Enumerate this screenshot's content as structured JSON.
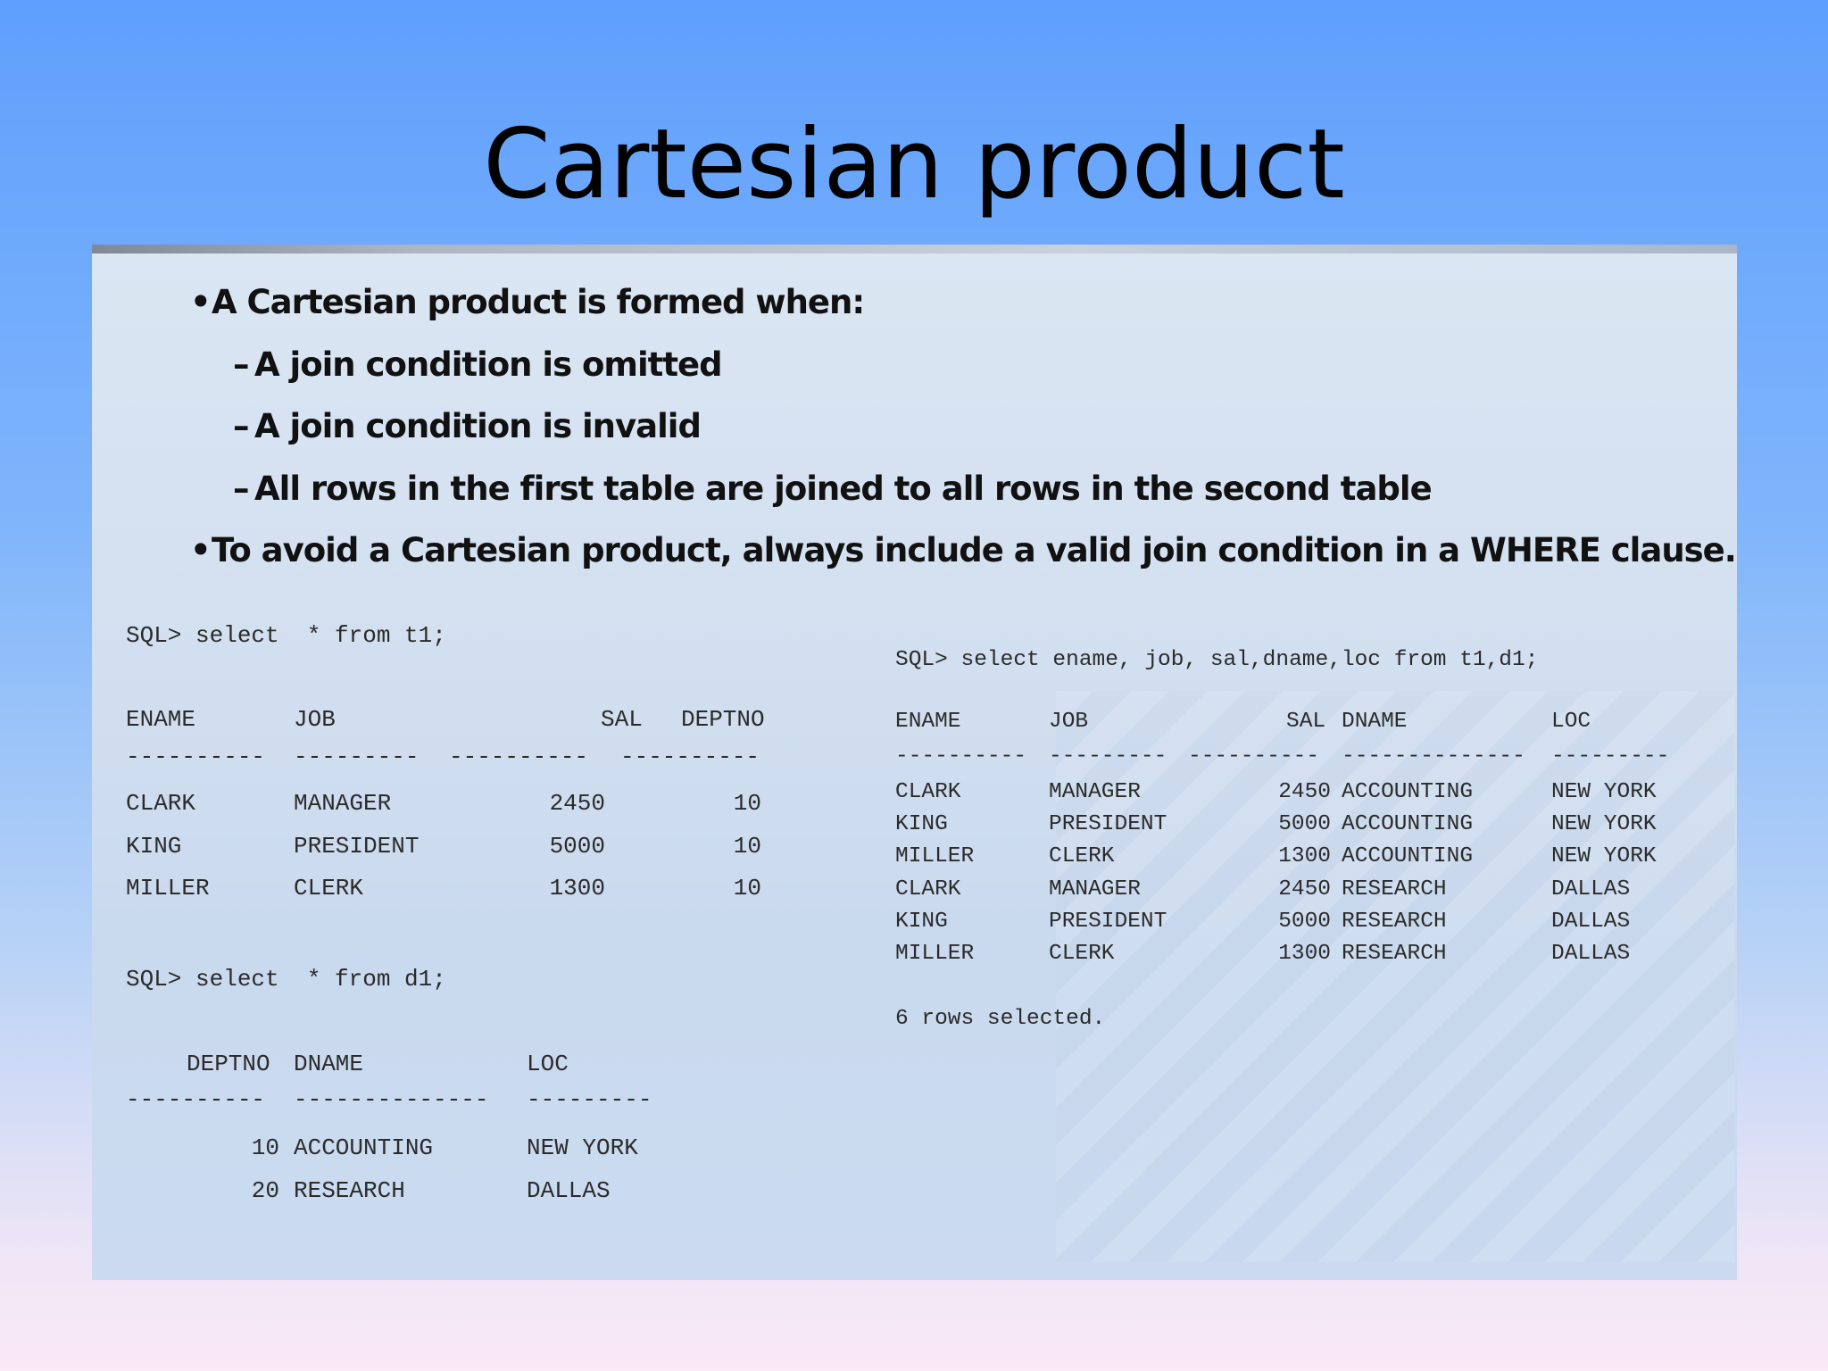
{
  "title": "Cartesian product",
  "bullets": [
    {
      "level": 1,
      "text": "A Cartesian product is formed when:"
    },
    {
      "level": 2,
      "text": "A join condition is omitted"
    },
    {
      "level": 2,
      "text": "A join condition is invalid"
    },
    {
      "level": 2,
      "text": "All rows in the first table are joined to all rows in the second table"
    },
    {
      "level": 1,
      "text": "To avoid a Cartesian product, always include a valid join condition in a WHERE clause."
    }
  ],
  "query_t1": {
    "prompt": "SQL> select  * from t1;",
    "headers": [
      "ENAME",
      "JOB",
      "SAL",
      "DEPTNO"
    ],
    "separator": [
      "----------",
      "---------",
      "----------",
      "----------"
    ],
    "rows": [
      [
        "CLARK",
        "MANAGER",
        "2450",
        "10"
      ],
      [
        "KING",
        "PRESIDENT",
        "5000",
        "10"
      ],
      [
        "MILLER",
        "CLERK",
        "1300",
        "10"
      ]
    ]
  },
  "query_d1": {
    "prompt": "SQL> select  * from d1;",
    "headers": [
      "DEPTNO",
      "DNAME",
      "LOC"
    ],
    "separator": [
      "----------",
      "--------------",
      "---------"
    ],
    "rows": [
      [
        "10",
        "ACCOUNTING",
        "NEW YORK"
      ],
      [
        "20",
        "RESEARCH",
        "DALLAS"
      ]
    ]
  },
  "query_join": {
    "prompt": "SQL> select ename, job, sal,dname,loc from t1,d1;",
    "headers": [
      "ENAME",
      "JOB",
      "SAL",
      "DNAME",
      "LOC"
    ],
    "separator": [
      "----------",
      "---------",
      "----------",
      "--------------",
      "---------"
    ],
    "rows": [
      [
        "CLARK",
        "MANAGER",
        "2450",
        "ACCOUNTING",
        "NEW YORK"
      ],
      [
        "KING",
        "PRESIDENT",
        "5000",
        "ACCOUNTING",
        "NEW YORK"
      ],
      [
        "MILLER",
        "CLERK",
        "1300",
        "ACCOUNTING",
        "NEW YORK"
      ],
      [
        "CLARK",
        "MANAGER",
        "2450",
        "RESEARCH",
        "DALLAS"
      ],
      [
        "KING",
        "PRESIDENT",
        "5000",
        "RESEARCH",
        "DALLAS"
      ],
      [
        "MILLER",
        "CLERK",
        "1300",
        "RESEARCH",
        "DALLAS"
      ]
    ],
    "footer": "6 rows selected."
  }
}
